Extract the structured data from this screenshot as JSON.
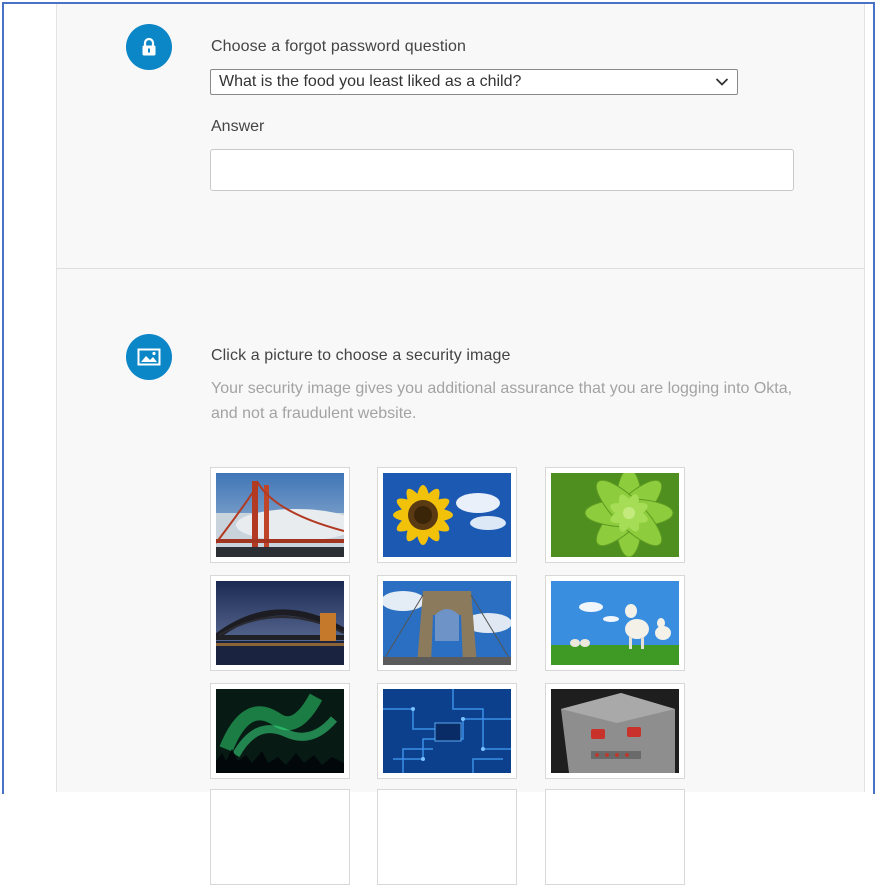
{
  "question_section": {
    "title": "Choose a forgot password question",
    "selected_question": "What is the food you least liked as a child?",
    "answer_label": "Answer",
    "answer_value": "",
    "icon": "lock-icon"
  },
  "image_section": {
    "title": "Click a picture to choose a security image",
    "description": "Your security image gives you additional assurance that you are logging into Okta, and not a fraudulent website.",
    "icon": "image-icon",
    "images": [
      "golden-gate-bridge",
      "sunflower",
      "succulent-plant",
      "harbour-bridge-night",
      "brooklyn-bridge",
      "lambs-in-field",
      "aurora-borealis",
      "circuit-board",
      "toy-robot"
    ]
  },
  "colors": {
    "accent": "#0b86c6",
    "panel": "#f8f8f8",
    "frame": "#4a72c4"
  }
}
